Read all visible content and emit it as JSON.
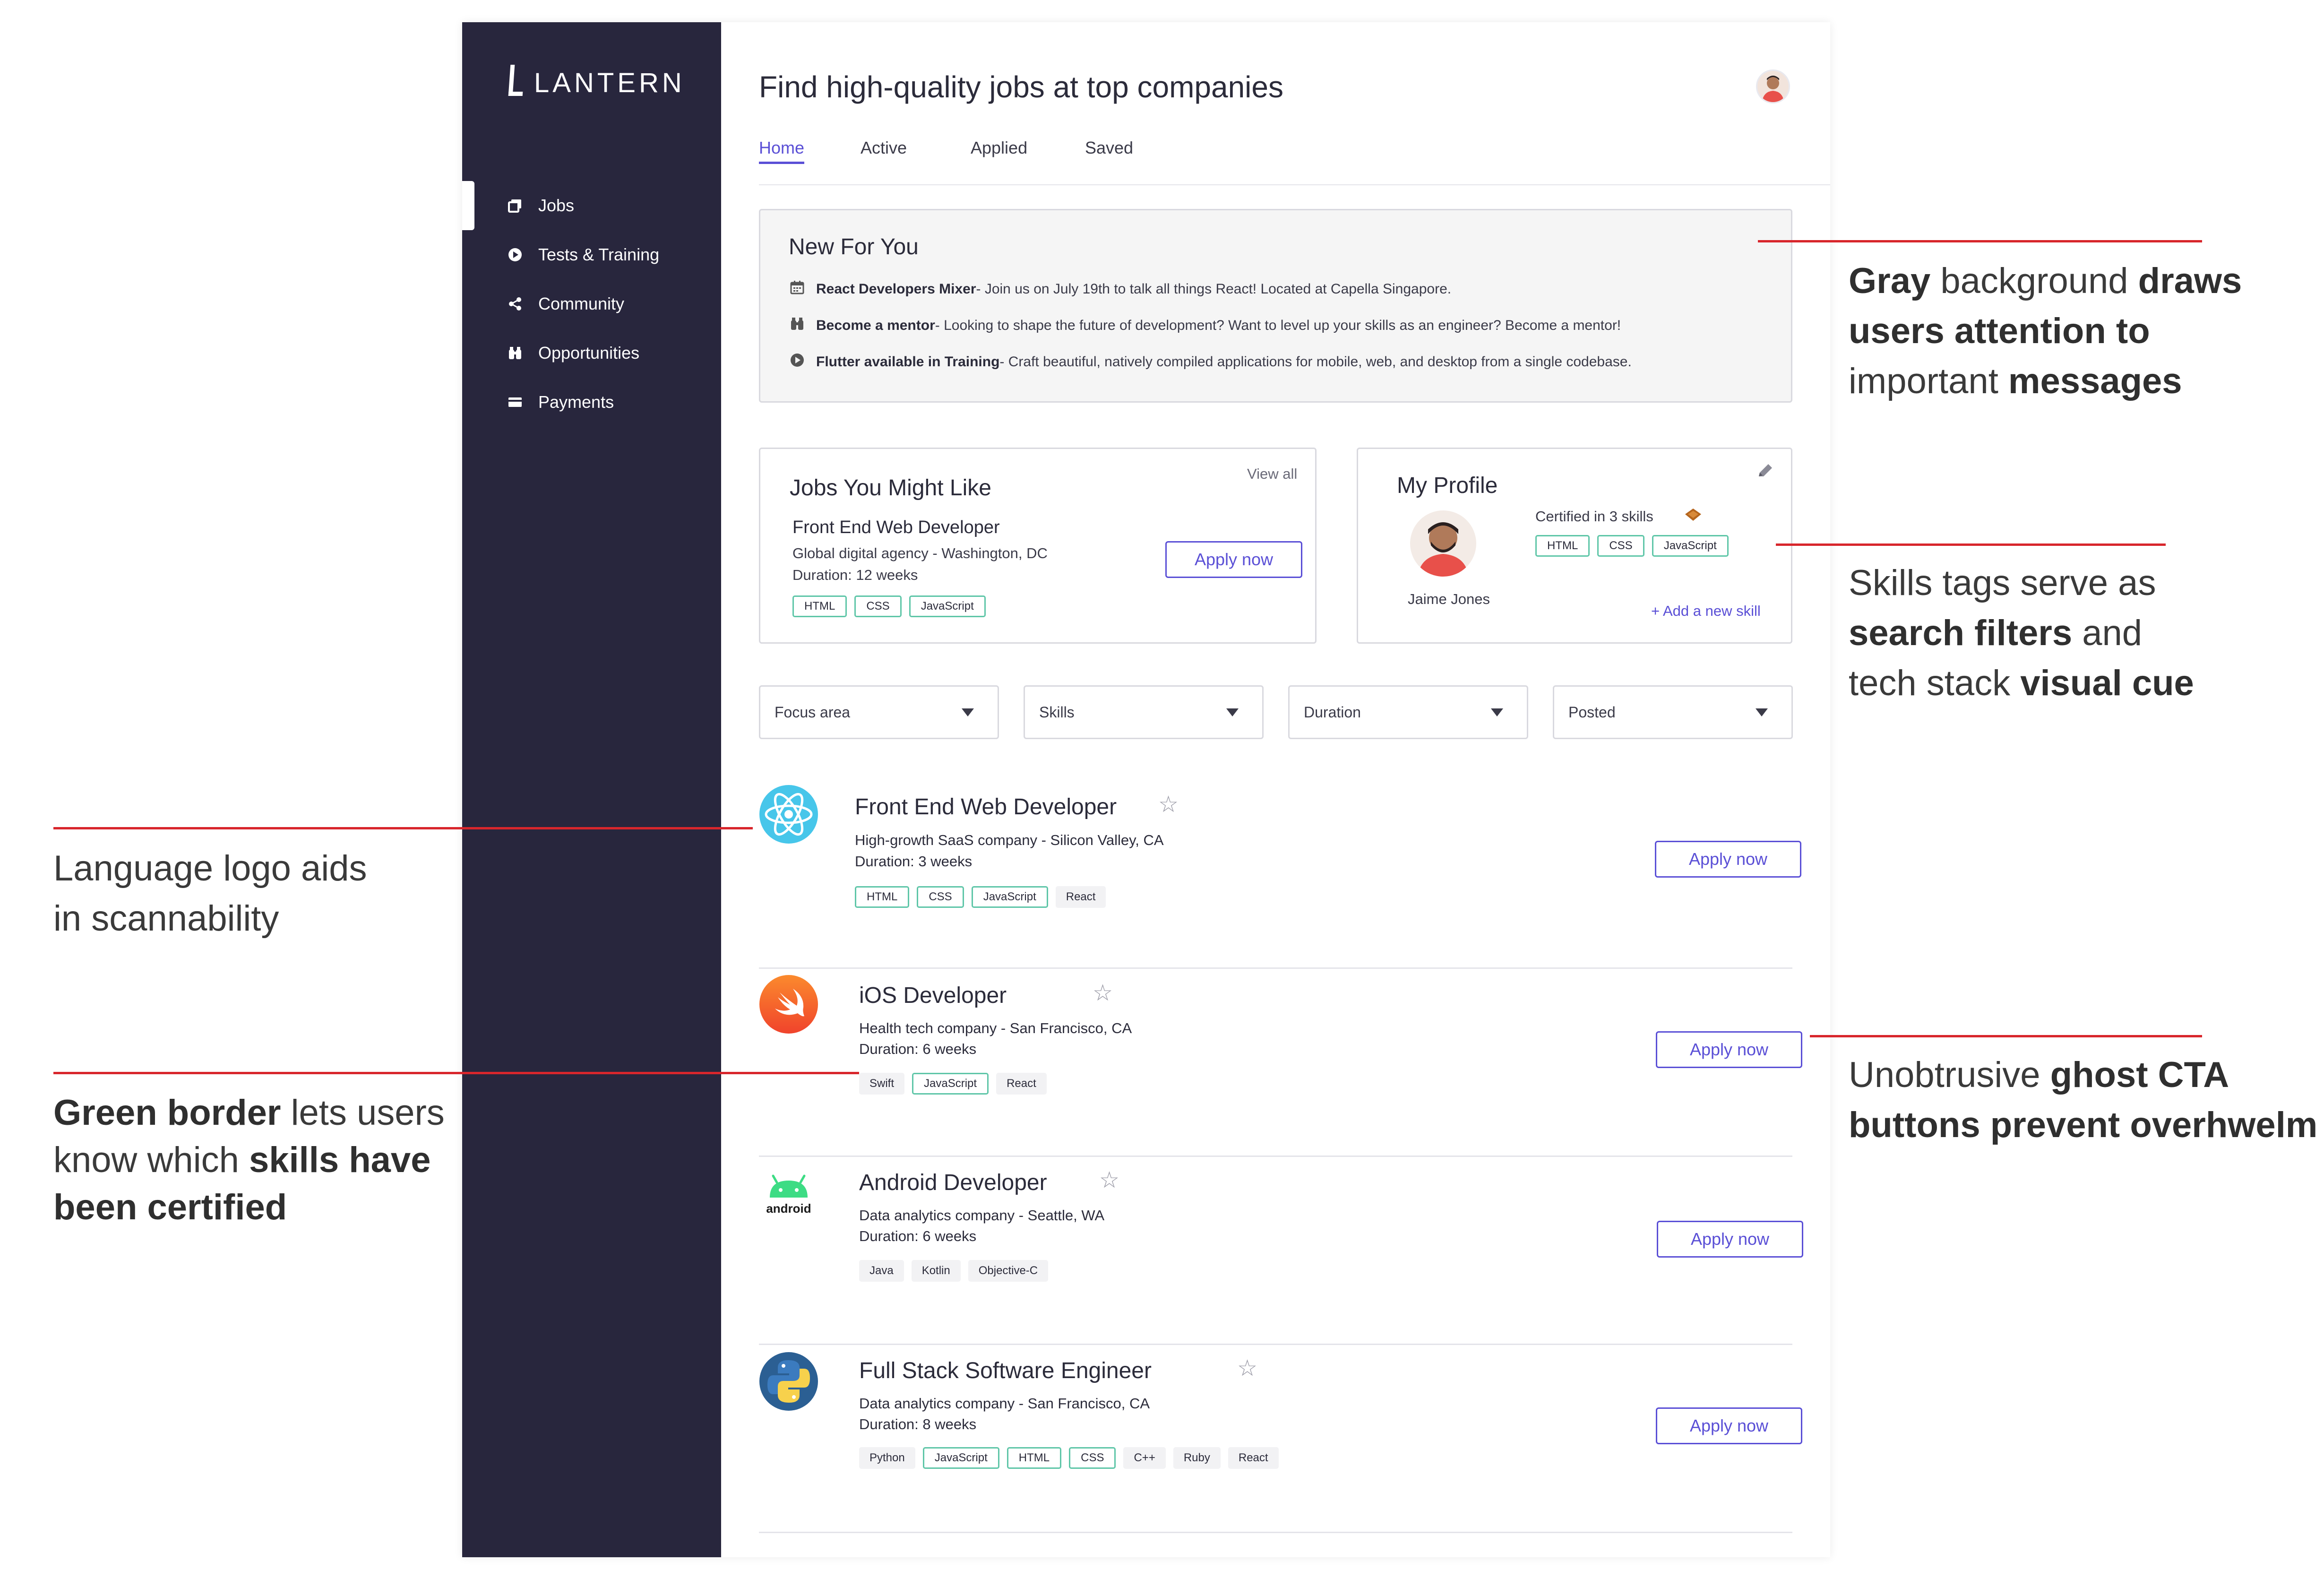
{
  "app": {
    "logo_text": "LANTERN",
    "page_title": "Find high-quality jobs at top companies",
    "accent_color": "#5a4fd6",
    "sidebar_color": "#28263d",
    "certified_border_color": "#5fc6a8"
  },
  "sidebar": {
    "items": [
      {
        "label": "Jobs",
        "icon": "jobs-icon"
      },
      {
        "label": "Tests & Training",
        "icon": "play-icon"
      },
      {
        "label": "Community",
        "icon": "share-icon"
      },
      {
        "label": "Opportunities",
        "icon": "binoculars-icon"
      },
      {
        "label": "Payments",
        "icon": "card-icon"
      }
    ]
  },
  "tabs": [
    "Home",
    "Active",
    "Applied",
    "Saved"
  ],
  "news": {
    "title": "New For You",
    "items": [
      {
        "bold": "React Developers Mixer",
        "text": " - Join us on July 19th to talk all things React! Located at Capella Singapore.",
        "icon": "calendar-icon"
      },
      {
        "bold": "Become a mentor",
        "text": " - Looking to shape the future of development? Want to level up your skills as an engineer? Become a mentor!",
        "icon": "people-icon"
      },
      {
        "bold": "Flutter available in Training",
        "text": " - Craft beautiful, natively compiled applications for mobile, web, and desktop from a single codebase.",
        "icon": "play-icon"
      }
    ]
  },
  "jobs_card": {
    "title": "Jobs You Might Like",
    "view_all": "View all",
    "job_title": "Front End Web Developer",
    "company": "Global digital agency - Washington, DC",
    "duration": "Duration: 12 weeks",
    "apply": "Apply now",
    "tags": [
      "HTML",
      "CSS",
      "JavaScript"
    ]
  },
  "profile_card": {
    "title": "My Profile",
    "name": "Jaime Jones",
    "certified": "Certified in 3 skills",
    "tags": [
      "HTML",
      "CSS",
      "JavaScript"
    ],
    "add_skill": "+ Add a new skill"
  },
  "filters": [
    "Focus area",
    "Skills",
    "Duration",
    "Posted"
  ],
  "jobs": [
    {
      "title": "Front End Web Developer",
      "company": "High-growth SaaS company - Silicon Valley, CA",
      "duration": "Duration: 3 weeks",
      "apply": "Apply now",
      "logo": "react-logo-icon",
      "tags": [
        {
          "label": "HTML",
          "cert": true
        },
        {
          "label": "CSS",
          "cert": true
        },
        {
          "label": "JavaScript",
          "cert": true
        },
        {
          "label": "React",
          "cert": false
        }
      ]
    },
    {
      "title": "iOS Developer",
      "company": "Health tech company - San Francisco, CA",
      "duration": "Duration: 6 weeks",
      "apply": "Apply now",
      "logo": "swift-logo-icon",
      "tags": [
        {
          "label": "Swift",
          "cert": false
        },
        {
          "label": "JavaScript",
          "cert": true
        },
        {
          "label": "React",
          "cert": false
        }
      ]
    },
    {
      "title": "Android Developer",
      "company": "Data analytics company - Seattle, WA",
      "duration": "Duration: 6 weeks",
      "apply": "Apply now",
      "logo": "android-logo-icon",
      "logo_text": "android",
      "tags": [
        {
          "label": "Java",
          "cert": false
        },
        {
          "label": "Kotlin",
          "cert": false
        },
        {
          "label": "Objective-C",
          "cert": false
        }
      ]
    },
    {
      "title": "Full Stack Software Engineer",
      "company": "Data analytics company - San Francisco, CA",
      "duration": "Duration: 8 weeks",
      "apply": "Apply now",
      "logo": "python-logo-icon",
      "tags": [
        {
          "label": "Python",
          "cert": false
        },
        {
          "label": "JavaScript",
          "cert": true
        },
        {
          "label": "HTML",
          "cert": true
        },
        {
          "label": "CSS",
          "cert": true
        },
        {
          "label": "C++",
          "cert": false
        },
        {
          "label": "Ruby",
          "cert": false
        },
        {
          "label": "React",
          "cert": false
        }
      ]
    }
  ],
  "annotations": {
    "gray": {
      "b1": "Gray",
      "t1": " background ",
      "b2": "draws",
      "b3": "users attention to",
      "t2": "important ",
      "b4": "messages"
    },
    "skills": {
      "t1": "Skills tags serve as",
      "b1": "search filters",
      "t2": " and",
      "t3": "tech stack ",
      "b2": "visual cue"
    },
    "ghost": {
      "t1": "Unobtrusive ",
      "b1": "ghost CTA",
      "b2": "buttons prevent overhwelm"
    },
    "logo": {
      "t1": "Language logo aids",
      "t2": "in scannability"
    },
    "green": {
      "b1": "Green border",
      "t1": " lets users",
      "t2": "know which ",
      "b2": "skills have",
      "b3": "been certified"
    },
    "line_color": "#d8262c"
  }
}
